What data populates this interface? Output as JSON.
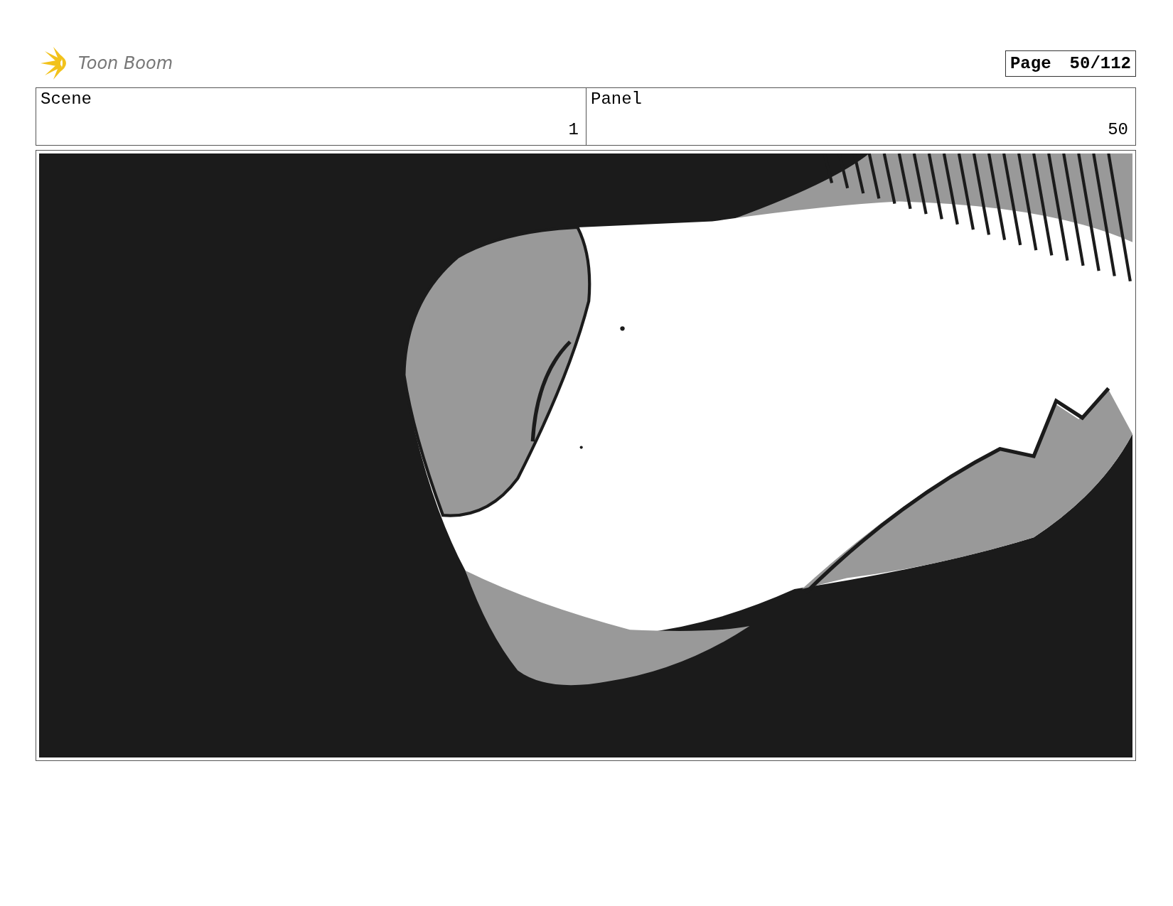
{
  "header": {
    "logo_text": "Toon Boom",
    "page_label": "Page",
    "page_number": "50/112"
  },
  "scene": {
    "label": "Scene",
    "number": "1"
  },
  "panel": {
    "label": "Panel",
    "number": "50"
  }
}
